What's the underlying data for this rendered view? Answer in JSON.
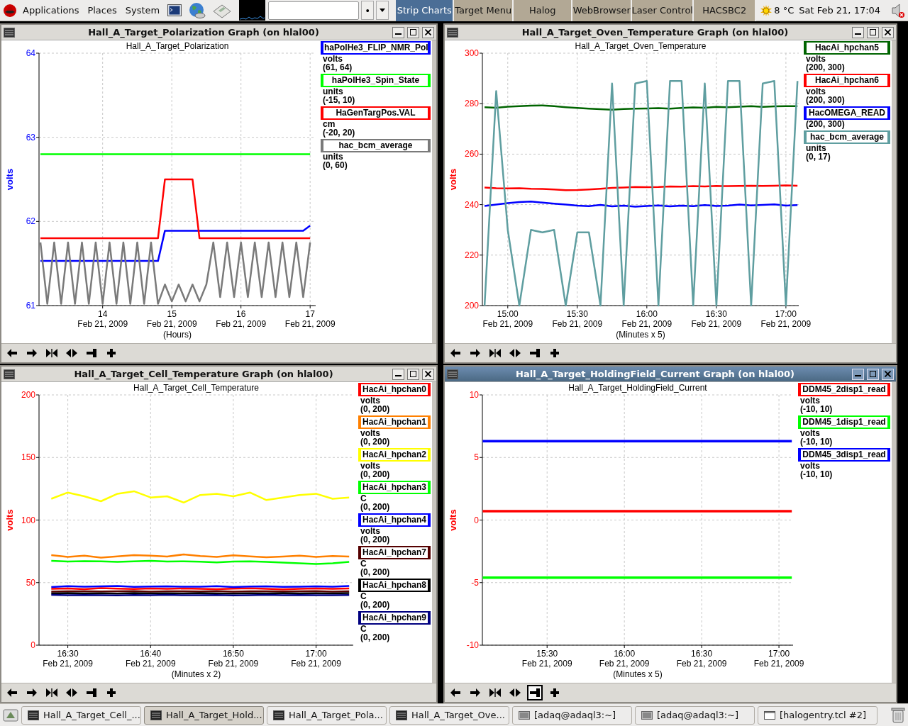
{
  "top_panel": {
    "menus": [
      "Applications",
      "Places",
      "System"
    ],
    "entry_button": "•",
    "launchers": [
      {
        "label": "Strip Charts",
        "selected": true
      },
      {
        "label": "Target Menu",
        "selected": false
      },
      {
        "label": "Halog",
        "selected": false
      },
      {
        "label": "WebBrowser",
        "selected": false
      },
      {
        "label": "Laser Control",
        "selected": false
      },
      {
        "label": "HACSBC2",
        "selected": false
      }
    ],
    "weather": "8 °C",
    "clock": "Sat Feb 21, 17:04"
  },
  "windows": [
    {
      "title": "Hall_A_Target_Polarization Graph (on hlal00)",
      "active": false,
      "chart_data": {
        "type": "line",
        "grid": true,
        "title": "Hall_A_Target_Polarization",
        "xlabel": "(Hours)",
        "ylabel": "volts",
        "ylim": [
          61,
          64
        ],
        "yticks": [
          61,
          62,
          63,
          64
        ],
        "categories": [
          null,
          null,
          null,
          null,
          null,
          null,
          null,
          null,
          null,
          "14\nFeb 21, 2009",
          null,
          null,
          null,
          null,
          null,
          null,
          null,
          null,
          null,
          "15\nFeb 21, 2009",
          null,
          null,
          null,
          null,
          null,
          null,
          null,
          null,
          null,
          "16\nFeb 21, 2009",
          null,
          null,
          null,
          null,
          null,
          null,
          null,
          null,
          null,
          "17\nFeb 21, 2009"
        ],
        "series": [
          {
            "name": "haPolHe3_FLIP_NMR_Pol",
            "color": "#0000ff",
            "values": [
              61.53,
              61.53,
              61.53,
              61.53,
              61.53,
              61.53,
              61.53,
              61.53,
              61.53,
              61.53,
              61.53,
              61.53,
              61.53,
              61.53,
              61.53,
              61.53,
              61.53,
              61.53,
              61.89,
              61.89,
              61.89,
              61.89,
              61.89,
              61.89,
              61.89,
              61.89,
              61.89,
              61.89,
              61.89,
              61.89,
              61.89,
              61.89,
              61.89,
              61.89,
              61.89,
              61.89,
              61.89,
              61.89,
              61.89,
              61.95
            ]
          },
          {
            "name": "haPolHe3_Spin_State",
            "color": "#00ff00",
            "values": [
              62.8,
              62.8,
              62.8,
              62.8,
              62.8,
              62.8,
              62.8,
              62.8,
              62.8,
              62.8,
              62.8,
              62.8,
              62.8,
              62.8,
              62.8,
              62.8,
              62.8,
              62.8,
              62.8,
              62.8,
              62.8,
              62.8,
              62.8,
              62.8,
              62.8,
              62.8,
              62.8,
              62.8,
              62.8,
              62.8,
              62.8,
              62.8,
              62.8,
              62.8,
              62.8,
              62.8,
              62.8,
              62.8,
              62.8,
              62.8
            ]
          },
          {
            "name": "HaGenTargPos.VAL",
            "color": "#ff0000",
            "values": [
              61.8,
              61.8,
              61.8,
              61.8,
              61.8,
              61.8,
              61.8,
              61.8,
              61.8,
              61.8,
              61.8,
              61.8,
              61.8,
              61.8,
              61.8,
              61.8,
              61.8,
              61.8,
              62.5,
              62.5,
              62.5,
              62.5,
              62.5,
              61.8,
              61.8,
              61.8,
              61.8,
              61.8,
              61.8,
              61.8,
              61.8,
              61.8,
              61.8,
              61.8,
              61.8,
              61.8,
              61.8,
              61.8,
              61.8,
              61.8
            ]
          },
          {
            "name": "hac_bcm_average",
            "color": "#7a7a7a",
            "values": [
              61.75,
              61.02,
              61.75,
              61.02,
              61.75,
              61.02,
              61.75,
              61.02,
              61.75,
              61.02,
              61.75,
              61.02,
              61.75,
              61.02,
              61.75,
              61.02,
              61.75,
              61.02,
              61.25,
              61.05,
              61.25,
              61.05,
              61.25,
              61.05,
              61.25,
              61.75,
              61.1,
              61.75,
              61.1,
              61.75,
              61.1,
              61.75,
              61.1,
              61.75,
              61.1,
              61.75,
              61.1,
              61.75,
              61.1,
              61.75
            ]
          }
        ]
      },
      "legend": [
        {
          "unit": "volts",
          "range": "(61, 64)"
        },
        {
          "unit": "units",
          "range": "(-15, 10)"
        },
        {
          "unit": "cm",
          "range": "(-20, 20)"
        },
        {
          "unit": "units",
          "range": "(0, 60)"
        }
      ],
      "toolbar": [
        {
          "kind": "back",
          "pressed": false
        },
        {
          "kind": "forward",
          "pressed": false
        },
        {
          "kind": "zoom-in",
          "pressed": false
        },
        {
          "kind": "zoom-out",
          "pressed": false
        },
        {
          "kind": "bar",
          "pressed": false
        },
        {
          "kind": "add",
          "pressed": false
        }
      ]
    },
    {
      "title": "Hall_A_Target_Oven_Temperature Graph (on hlal00)",
      "active": false,
      "chart_data": {
        "type": "line",
        "grid": true,
        "title": "Hall_A_Target_Oven_Temperature",
        "xlabel": "(Minutes x 5)",
        "ylabel": "volts",
        "ylim": [
          200,
          300
        ],
        "yticks": [
          200,
          220,
          240,
          260,
          280,
          300
        ],
        "categories": [
          null,
          null,
          "15:00\nFeb 21, 2009",
          null,
          null,
          null,
          null,
          null,
          "15:30\nFeb 21, 2009",
          null,
          null,
          null,
          null,
          null,
          "16:00\nFeb 21, 2009",
          null,
          null,
          null,
          null,
          null,
          "16:30\nFeb 21, 2009",
          null,
          null,
          null,
          null,
          null,
          "17:00\nFeb 21, 2009",
          null
        ],
        "series": [
          {
            "name": "HacAi_hpchan5",
            "color": "#006400",
            "values": [
              278.6,
              278.4,
              278.8,
              279,
              279.2,
              279.3,
              279,
              278.6,
              278.3,
              278,
              277.8,
              277.6,
              277.9,
              278,
              278.1,
              278.2,
              278,
              278.3,
              278.5,
              278.4,
              278.7,
              278.6,
              278.8,
              279,
              278.7,
              278.9,
              279,
              279
            ]
          },
          {
            "name": "HacAi_hpchan6",
            "color": "#ff0000",
            "values": [
              246.8,
              246.5,
              246.4,
              246.5,
              246.3,
              246.2,
              246,
              245.7,
              245.8,
              246,
              246.3,
              246.6,
              246.8,
              247,
              246.9,
              247,
              247.2,
              247.1,
              247.3,
              247.2,
              247.4,
              247.3,
              247.4,
              247.5,
              247.4,
              247.5,
              247.6,
              247.5
            ]
          },
          {
            "name": "HacOMEGA_READ",
            "color": "#0000ff",
            "values": [
              239.5,
              240,
              240.6,
              241,
              241.2,
              240.8,
              240.4,
              240,
              239.6,
              239.4,
              239.9,
              239.3,
              239.6,
              239.2,
              239.5,
              239.7,
              239.3,
              239.6,
              239.4,
              239.8,
              239.5,
              239.6,
              240,
              239.7,
              239.9,
              240.1,
              239.6,
              239.8
            ]
          },
          {
            "name": "hac_bcm_average",
            "color": "#5f9ea0",
            "values": [
              200,
              285,
              230,
              200,
              230,
              229,
              230,
              200,
              229,
              229,
              200,
              288,
              200,
              288,
              289,
              200,
              289,
              289,
              200,
              288,
              200,
              289,
              289,
              200,
              288,
              289,
              200,
              289
            ]
          }
        ]
      },
      "legend": [
        {
          "unit": "volts",
          "range": "(200, 300)"
        },
        {
          "unit": "volts",
          "range": "(200, 300)"
        },
        {
          "range": "(200, 300)"
        },
        {
          "unit": "units",
          "range": "(0, 17)"
        }
      ],
      "toolbar": [
        {
          "kind": "back",
          "pressed": false
        },
        {
          "kind": "forward",
          "pressed": false
        },
        {
          "kind": "zoom-in",
          "pressed": false
        },
        {
          "kind": "zoom-out",
          "pressed": false
        },
        {
          "kind": "bar",
          "pressed": false
        },
        {
          "kind": "add",
          "pressed": false
        }
      ]
    },
    {
      "title": "Hall_A_Target_Cell_Temperature Graph (on hlal00)",
      "active": false,
      "chart_data": {
        "type": "line",
        "grid": true,
        "title": "Hall_A_Target_Cell_Temperature",
        "xlabel": "(Minutes x 2)",
        "ylabel": "volts",
        "ylim": [
          0,
          200
        ],
        "yticks": [
          0,
          50,
          100,
          150,
          200
        ],
        "categories": [
          null,
          "16:30\nFeb 21, 2009",
          null,
          null,
          null,
          null,
          "16:40\nFeb 21, 2009",
          null,
          null,
          null,
          null,
          "16:50\nFeb 21, 2009",
          null,
          null,
          null,
          null,
          "17:00\nFeb 21, 2009",
          null,
          null
        ],
        "series": [
          {
            "name": "HacAi_hpchan0",
            "color": "#ff0000",
            "values": [
              45,
              45.3,
              44.8,
              45.6,
              45.2,
              44.9,
              45.4,
              45,
              45.3,
              45.1,
              44.7,
              45.2,
              45.5,
              45,
              44.6,
              45.1,
              45.4,
              45,
              45.3
            ]
          },
          {
            "name": "HacAi_hpchan1",
            "color": "#ff8000",
            "values": [
              72,
              70.5,
              71.5,
              70,
              71,
              72,
              71.5,
              70.8,
              72.5,
              71.2,
              70.5,
              71.8,
              71,
              70.2,
              70.8,
              71.5,
              70.6,
              71.2,
              70.8
            ]
          },
          {
            "name": "HacAi_hpchan2",
            "color": "#ffff00",
            "values": [
              117,
              122,
              119,
              115,
              121,
              123,
              118,
              119,
              114,
              120,
              121,
              119,
              122,
              116,
              118,
              120,
              121,
              117,
              118
            ]
          },
          {
            "name": "HacAi_hpchan3",
            "color": "#00ff00",
            "values": [
              67.5,
              66.8,
              67.2,
              67,
              66.5,
              67,
              67.4,
              66.8,
              67,
              66.7,
              66.2,
              66.8,
              67,
              66.5,
              66,
              65.5,
              64.8,
              65.5,
              66.5
            ]
          },
          {
            "name": "HacAi_hpchan4",
            "color": "#0000ff",
            "values": [
              46.5,
              47.2,
              46.8,
              47,
              47.3,
              46.6,
              46.9,
              47.1,
              46.7,
              46.8,
              47.2,
              46.5,
              46.9,
              47,
              46.6,
              46.8,
              47.1,
              46.7,
              47.3
            ]
          },
          {
            "name": "HacAi_hpchan7",
            "color": "#550000",
            "values": [
              42.8,
              43,
              43.1,
              42.9,
              43,
              43.2,
              42.7,
              43,
              43.1,
              42.9,
              43.2,
              42.8,
              43,
              43.1,
              42.9,
              43,
              43.2,
              42.8,
              43
            ]
          },
          {
            "name": "HacAi_hpchan8",
            "color": "#000000",
            "values": [
              41.3,
              41.6,
              41.4,
              41.5,
              41.2,
              41.6,
              41.4,
              41.5,
              41.3,
              41.6,
              41.4,
              41.2,
              41.5,
              41.4,
              41.6,
              41.3,
              41.5,
              41.4,
              41.6
            ]
          },
          {
            "name": "HacAi_hpchan9",
            "color": "#000080",
            "values": [
              40.2,
              39.9,
              40.1,
              40,
              39.8,
              40.1,
              40,
              40.2,
              39.9,
              40,
              40.1,
              39.8,
              40,
              40.2,
              39.9,
              40.1,
              40,
              39.9,
              40.1
            ]
          }
        ]
      },
      "legend": [
        {
          "unit": "volts",
          "range": "(0, 200)"
        },
        {
          "unit": "volts",
          "range": "(0, 200)"
        },
        {
          "unit": "volts",
          "range": "(0, 200)"
        },
        {
          "unit": "C",
          "range": "(0, 200)"
        },
        {
          "unit": "volts",
          "range": "(0, 200)"
        },
        {
          "unit": "C",
          "range": "(0, 200)"
        },
        {
          "unit": "C",
          "range": "(0, 200)"
        },
        {
          "unit": "C",
          "range": "(0, 200)"
        }
      ],
      "toolbar": [
        {
          "kind": "back",
          "pressed": false
        },
        {
          "kind": "forward",
          "pressed": false
        },
        {
          "kind": "zoom-in",
          "pressed": false
        },
        {
          "kind": "zoom-out",
          "pressed": false
        },
        {
          "kind": "bar",
          "pressed": false
        },
        {
          "kind": "add",
          "pressed": false
        }
      ]
    },
    {
      "title": "Hall_A_Target_HoldingField_Current Graph (on hlal00)",
      "active": true,
      "chart_data": {
        "type": "line",
        "grid": true,
        "title": "Hall_A_Target_HoldingField_Current",
        "xlabel": "(Minutes x 5)",
        "ylabel": "volts",
        "ylim": [
          -10,
          10
        ],
        "yticks": [
          -10,
          -5,
          0,
          5,
          10
        ],
        "categories": [
          null,
          null,
          null,
          null,
          null,
          "15:30\nFeb 21, 2009",
          null,
          null,
          null,
          null,
          null,
          "16:00\nFeb 21, 2009",
          null,
          null,
          null,
          null,
          null,
          "16:30\nFeb 21, 2009",
          null,
          null,
          null,
          null,
          null,
          "17:00\nFeb 21, 2009",
          null
        ],
        "series": [
          {
            "name": "DDM45_2disp1_read",
            "color": "#ff0000",
            "values": [
              0.7,
              0.7,
              0.7,
              0.7,
              0.7,
              0.7,
              0.7,
              0.7,
              0.7,
              0.7,
              0.7,
              0.7,
              0.7,
              0.7,
              0.7,
              0.7,
              0.7,
              0.7,
              0.7,
              0.7,
              0.7,
              0.7,
              0.7,
              0.7,
              0.7
            ]
          },
          {
            "name": "DDM45_1disp1_read",
            "color": "#00ff00",
            "values": [
              -4.6,
              -4.6,
              -4.6,
              -4.6,
              -4.6,
              -4.6,
              -4.6,
              -4.6,
              -4.6,
              -4.6,
              -4.6,
              -4.6,
              -4.6,
              -4.6,
              -4.6,
              -4.6,
              -4.6,
              -4.6,
              -4.6,
              -4.6,
              -4.6,
              -4.6,
              -4.6,
              -4.6,
              -4.6
            ]
          },
          {
            "name": "DDM45_3disp1_read",
            "color": "#0000ff",
            "values": [
              6.3,
              6.3,
              6.3,
              6.3,
              6.3,
              6.3,
              6.3,
              6.3,
              6.3,
              6.3,
              6.3,
              6.3,
              6.3,
              6.3,
              6.3,
              6.3,
              6.3,
              6.3,
              6.3,
              6.3,
              6.3,
              6.3,
              6.3,
              6.3,
              6.3
            ]
          }
        ]
      },
      "legend": [
        {
          "unit": "volts",
          "range": "(-10, 10)"
        },
        {
          "unit": "volts",
          "range": "(-10, 10)"
        },
        {
          "unit": "volts",
          "range": "(-10, 10)"
        }
      ],
      "toolbar": [
        {
          "kind": "back",
          "pressed": false
        },
        {
          "kind": "forward",
          "pressed": false
        },
        {
          "kind": "zoom-in",
          "pressed": false
        },
        {
          "kind": "zoom-out",
          "pressed": false
        },
        {
          "kind": "bar",
          "pressed": true
        },
        {
          "kind": "add",
          "pressed": false
        }
      ]
    }
  ],
  "taskbar": [
    {
      "kind": "graph",
      "label": "Hall_A_Target_Cell_...",
      "selected": false
    },
    {
      "kind": "graph",
      "label": "Hall_A_Target_Hold...",
      "selected": true
    },
    {
      "kind": "graph",
      "label": "Hall_A_Target_Pola...",
      "selected": false
    },
    {
      "kind": "graph",
      "label": "Hall_A_Target_Ove...",
      "selected": false
    },
    {
      "kind": "terminal",
      "label": "[adaq@adaql3:~]",
      "selected": false
    },
    {
      "kind": "terminal",
      "label": "[adaq@adaql3:~]",
      "selected": false
    },
    {
      "kind": "window",
      "label": "[halogentry.tcl #2]",
      "selected": false
    }
  ]
}
